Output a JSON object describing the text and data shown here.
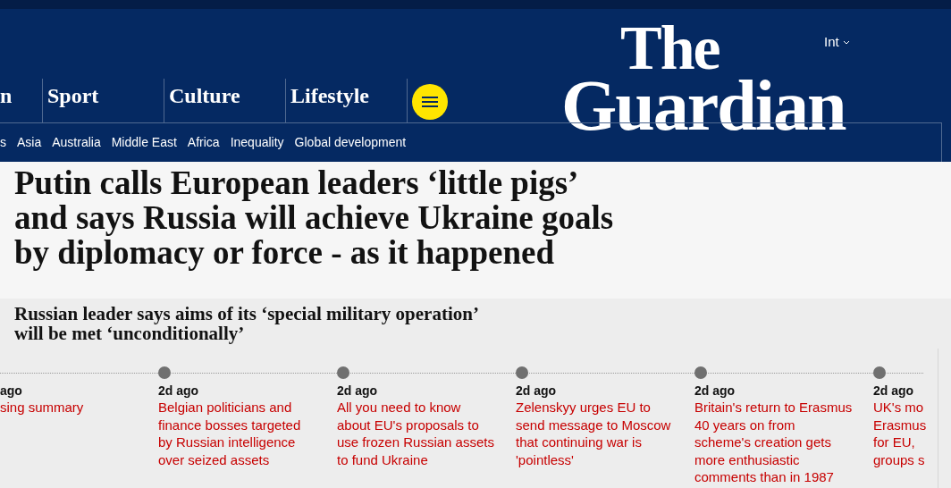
{
  "header": {
    "edition": "Int",
    "logo": [
      "The",
      "Guardian"
    ],
    "pillars": [
      {
        "label": "n"
      },
      {
        "label": "Sport"
      },
      {
        "label": "Culture"
      },
      {
        "label": "Lifestyle"
      }
    ],
    "subnav": [
      "s",
      "Asia",
      "Australia",
      "Middle East",
      "Africa",
      "Inequality",
      "Global development"
    ]
  },
  "article": {
    "headline": "Putin calls European leaders ‘little pigs’ and says Russia will achieve Ukraine goals by diplomacy or force - as it happened",
    "standfirst": "Russian leader says aims of its ‘special military operation’ will be met ‘unconditionally’"
  },
  "timeline": [
    {
      "time": "ago",
      "headline": "sing summary"
    },
    {
      "time": "2d ago",
      "headline": "Belgian politicians and finance bosses targeted by Russian intelligence over seized assets"
    },
    {
      "time": "2d ago",
      "headline": "All you need to know about EU's proposals to use frozen Russian assets to fund Ukraine"
    },
    {
      "time": "2d ago",
      "headline": "Zelenskyy urges EU to send message to Moscow that continuing war is 'pointless'"
    },
    {
      "time": "2d ago",
      "headline": "Britain's return to Erasmus 40 years on from scheme's creation gets more enthusiastic comments than in 1987"
    },
    {
      "time": "2d ago",
      "headline": "UK's mo\nErasmus\nfor EU,\ngroups s"
    }
  ]
}
